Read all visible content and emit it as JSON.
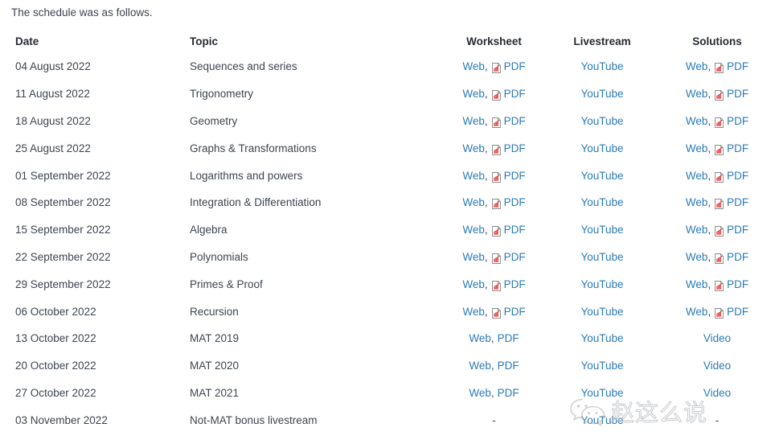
{
  "intro": {
    "text": "The schedule was as follows."
  },
  "table": {
    "headers": {
      "date": "Date",
      "topic": "Topic",
      "worksheet": "Worksheet",
      "livestream": "Livestream",
      "solutions": "Solutions"
    },
    "links": {
      "web": "Web",
      "pdf": "PDF",
      "youtube": "YouTube",
      "video": "Video",
      "comma": ",",
      "dash": "-"
    },
    "rows": [
      {
        "date": "04 August 2022",
        "topic": "Sequences and series",
        "worksheet": {
          "type": "web-pdf-icon"
        },
        "livestream": {
          "type": "youtube"
        },
        "solutions": {
          "type": "web-pdf-icon"
        }
      },
      {
        "date": "11 August 2022",
        "topic": "Trigonometry",
        "worksheet": {
          "type": "web-pdf-icon"
        },
        "livestream": {
          "type": "youtube"
        },
        "solutions": {
          "type": "web-pdf-icon"
        }
      },
      {
        "date": "18 August 2022",
        "topic": "Geometry",
        "worksheet": {
          "type": "web-pdf-icon"
        },
        "livestream": {
          "type": "youtube"
        },
        "solutions": {
          "type": "web-pdf-icon"
        }
      },
      {
        "date": "25 August 2022",
        "topic": "Graphs & Transformations",
        "worksheet": {
          "type": "web-pdf-icon"
        },
        "livestream": {
          "type": "youtube"
        },
        "solutions": {
          "type": "web-pdf-icon"
        }
      },
      {
        "date": "01 September 2022",
        "topic": "Logarithms and powers",
        "worksheet": {
          "type": "web-pdf-icon"
        },
        "livestream": {
          "type": "youtube"
        },
        "solutions": {
          "type": "web-pdf-icon"
        }
      },
      {
        "date": "08 September 2022",
        "topic": "Integration & Differentiation",
        "worksheet": {
          "type": "web-pdf-icon"
        },
        "livestream": {
          "type": "youtube"
        },
        "solutions": {
          "type": "web-pdf-icon"
        }
      },
      {
        "date": "15 September 2022",
        "topic": "Algebra",
        "worksheet": {
          "type": "web-pdf-icon"
        },
        "livestream": {
          "type": "youtube"
        },
        "solutions": {
          "type": "web-pdf-icon"
        }
      },
      {
        "date": "22 September 2022",
        "topic": "Polynomials",
        "worksheet": {
          "type": "web-pdf-icon"
        },
        "livestream": {
          "type": "youtube"
        },
        "solutions": {
          "type": "web-pdf-icon"
        }
      },
      {
        "date": "29 September 2022",
        "topic": "Primes & Proof",
        "worksheet": {
          "type": "web-pdf-icon"
        },
        "livestream": {
          "type": "youtube"
        },
        "solutions": {
          "type": "web-pdf-icon"
        }
      },
      {
        "date": "06 October 2022",
        "topic": "Recursion",
        "worksheet": {
          "type": "web-pdf-icon"
        },
        "livestream": {
          "type": "youtube"
        },
        "solutions": {
          "type": "web-pdf-icon"
        }
      },
      {
        "date": "13 October 2022",
        "topic": "MAT 2019",
        "worksheet": {
          "type": "web-pdf"
        },
        "livestream": {
          "type": "youtube"
        },
        "solutions": {
          "type": "video"
        }
      },
      {
        "date": "20 October 2022",
        "topic": "MAT 2020",
        "worksheet": {
          "type": "web-pdf"
        },
        "livestream": {
          "type": "youtube"
        },
        "solutions": {
          "type": "video"
        }
      },
      {
        "date": "27 October 2022",
        "topic": "MAT 2021",
        "worksheet": {
          "type": "web-pdf"
        },
        "livestream": {
          "type": "youtube"
        },
        "solutions": {
          "type": "video"
        }
      },
      {
        "date": "03 November 2022",
        "topic": "Not-MAT bonus livestream",
        "worksheet": {
          "type": "dash"
        },
        "livestream": {
          "type": "youtube"
        },
        "solutions": {
          "type": "dash"
        }
      }
    ]
  },
  "watermark": {
    "text": "赵这么说",
    "logo": "wechat-icon"
  },
  "colors": {
    "link": "#2b7bb9",
    "text": "#3d4550",
    "header_text": "#262b33",
    "pdf_icon_red": "#e03030",
    "background": "#ffffff"
  }
}
